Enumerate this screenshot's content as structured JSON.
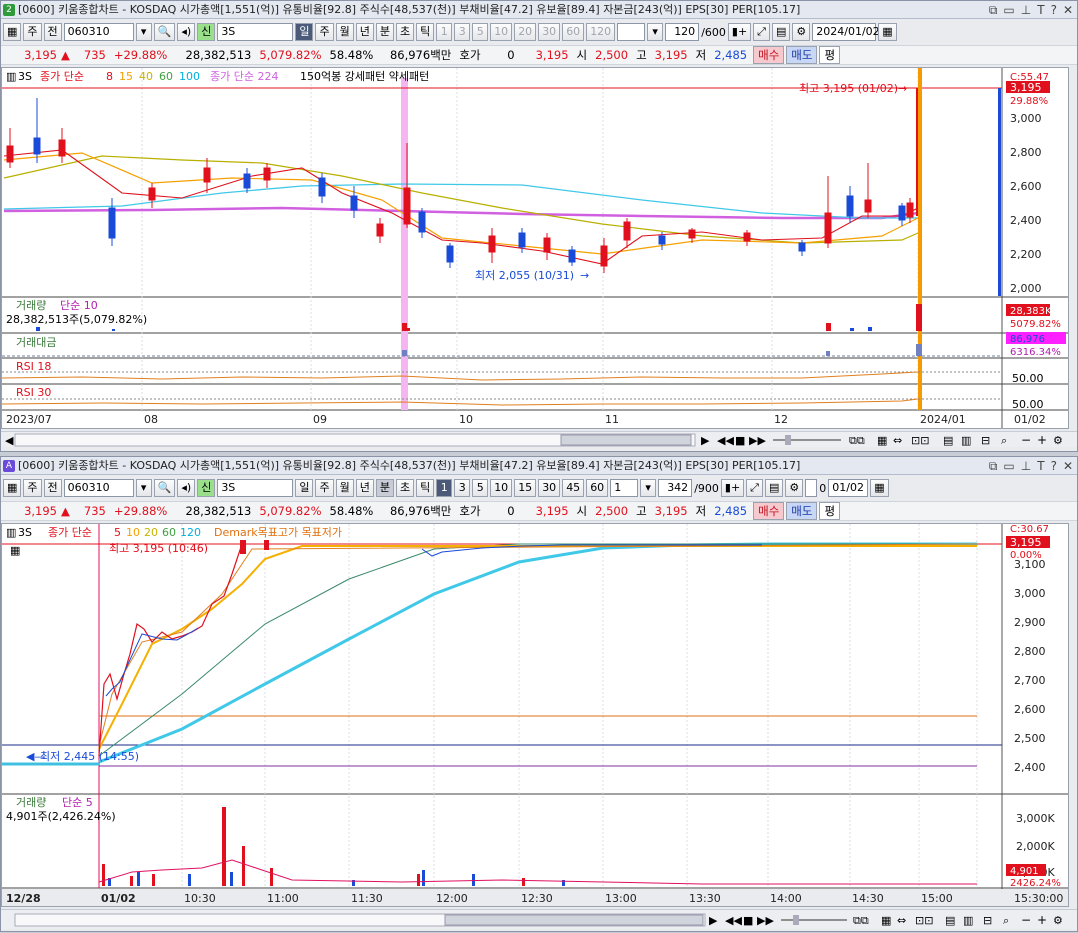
{
  "w1": {
    "winnum": "2",
    "title": "[0600] 키움종합차트 - KOSDAQ 시가총액[1,551(억)] 유통비율[92.8] 주식수[48,537(천)] 부채비율[47.2] 유보율[89.4] 자본금[243(억)] EPS[30] PER[105.17]",
    "toolbar": {
      "period_labels": [
        "주",
        "전"
      ],
      "code": "060310",
      "sin": "신",
      "name": "3S",
      "tabs": [
        "일",
        "주",
        "월",
        "년",
        "분",
        "초",
        "틱"
      ],
      "active_tab": "일",
      "numbers": [
        "1",
        "3",
        "5",
        "10",
        "20",
        "30",
        "60",
        "120"
      ],
      "count": "120",
      "total": "/600",
      "date": "2024/01/02"
    },
    "quote": {
      "price": "3,195",
      "change": "735",
      "change_pct": "+29.88%",
      "volume": "28,382,513",
      "vol_pct": "5,079.82%",
      "turnover": "58.48%",
      "amount": "86,976백만",
      "hoga_label": "호가",
      "hoga": "0",
      "hoga_price": "3,195",
      "open_label": "시",
      "open": "2,500",
      "high_label": "고",
      "high": "3,195",
      "low_label": "저",
      "low": "2,485",
      "buy": "매수",
      "sell": "매도",
      "avg": "평"
    },
    "legend": {
      "stock": "3S",
      "ma_label": "종가 단순",
      "ma_periods": [
        "8",
        "15",
        "40",
        "60",
        "100"
      ],
      "ma_colors": [
        "#e0101c",
        "#f5a000",
        "#c8b400",
        "#40a040",
        "#00b0e0"
      ],
      "ma2": "종가 단순 224",
      "pattern": "150억봉 강세패턴 약세패턴"
    },
    "price_axis": [
      "3,000",
      "2,800",
      "2,600",
      "2,400",
      "2,200",
      "2,000"
    ],
    "price_tags": {
      "top": "C:55.47",
      "cur": "3,195",
      "pct": "29.88%"
    },
    "high_note": "최고 3,195 (01/02)",
    "low_note": "최저 2,055 (10/31)",
    "vol_panel": {
      "label": "거래량",
      "ma": "단순 10",
      "value": "28,382,513주(5,079.82%)",
      "tag1": "28,383K",
      "tag2": "5079.82%"
    },
    "amt_panel": {
      "label": "거래대금",
      "tag1": "86,976",
      "tag2": "6316.34%"
    },
    "rsi1": {
      "label": "RSI 18",
      "level": "50.00"
    },
    "rsi2": {
      "label": "RSI 30",
      "level": "50.00"
    },
    "x_axis": [
      "2023/07",
      "08",
      "09",
      "10",
      "11",
      "12",
      "2024/01",
      "01/02"
    ]
  },
  "w2": {
    "winnum": "A",
    "title": "[0600] 키움종합차트 - KOSDAQ 시가총액[1,551(억)] 유통비율[92.8] 주식수[48,537(천)] 부채비율[47.2] 유보율[89.4] 자본금[243(억)] EPS[30] PER[105.17]",
    "toolbar": {
      "period_labels": [
        "주",
        "전"
      ],
      "code": "060310",
      "sin": "신",
      "name": "3S",
      "tabs": [
        "일",
        "주",
        "월",
        "년",
        "분",
        "초",
        "틱"
      ],
      "active_tab": "분",
      "numbers": [
        "1",
        "3",
        "5",
        "10",
        "15",
        "30",
        "45",
        "60"
      ],
      "minute": "1",
      "count": "342",
      "total": "/900",
      "chk": "0",
      "date": "01/02"
    },
    "quote": {
      "price": "3,195",
      "change": "735",
      "change_pct": "+29.88%",
      "volume": "28,382,513",
      "vol_pct": "5,079.82%",
      "turnover": "58.48%",
      "amount": "86,976백만",
      "hoga_label": "호가",
      "hoga": "0",
      "hoga_price": "3,195",
      "open_label": "시",
      "open": "2,500",
      "high_label": "고",
      "high": "3,195",
      "low_label": "저",
      "low": "2,485",
      "buy": "매수",
      "sell": "매도",
      "avg": "평"
    },
    "legend": {
      "stock": "3S",
      "ma_label": "종가 단순",
      "ma_periods": [
        "5",
        "10",
        "20",
        "60",
        "120"
      ],
      "ma_colors": [
        "#e0101c",
        "#f5a000",
        "#c8b400",
        "#40a040",
        "#00b0e0"
      ],
      "demark": "Demark목표고가 목표저가"
    },
    "price_axis": [
      "3,100",
      "3,000",
      "2,900",
      "2,800",
      "2,700",
      "2,600",
      "2,500",
      "2,400"
    ],
    "price_tags": {
      "top": "C:30.67",
      "cur": "3,195",
      "pct": "0.00%"
    },
    "high_note": "최고 3,195 (10:46)",
    "low_note": "최저 2,445 (14:55)",
    "vol_panel": {
      "label": "거래량",
      "ma": "단순 5",
      "value": "4,901주(2,426.24%)",
      "tag1": "4,901",
      "tag2": "2426.24%"
    },
    "vol_axis": [
      "3,000K",
      "2,000K",
      "1,000K"
    ],
    "x_axis": [
      "12/28",
      "01/02",
      "10:30",
      "11:00",
      "11:30",
      "12:00",
      "12:30",
      "13:00",
      "13:30",
      "14:00",
      "14:30",
      "15:00",
      "15:30:00"
    ]
  }
}
